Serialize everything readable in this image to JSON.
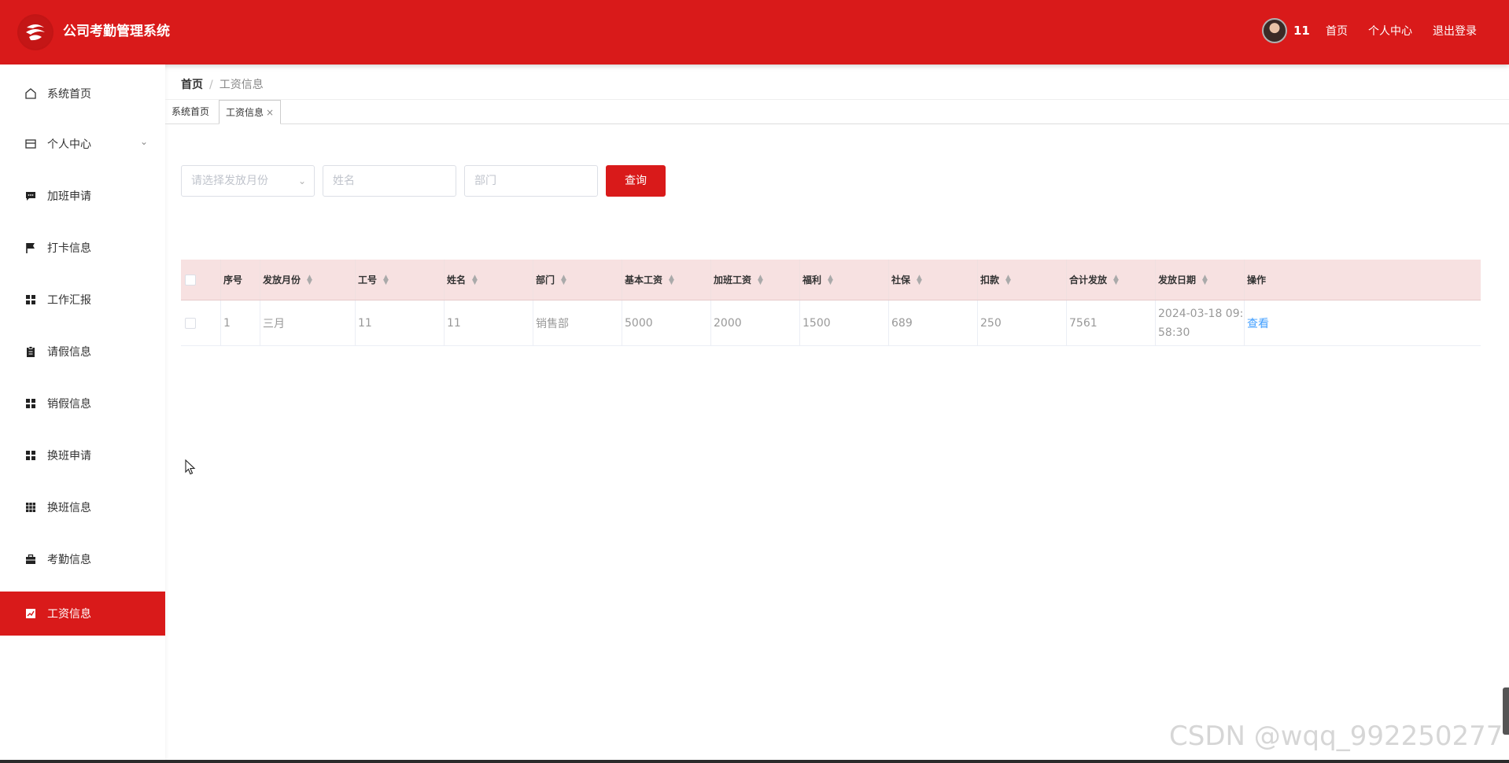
{
  "header": {
    "title": "公司考勤管理系统",
    "username": "11",
    "links": {
      "home": "首页",
      "profile": "个人中心",
      "logout": "退出登录"
    },
    "colors": {
      "primary": "#d91a1a"
    }
  },
  "sidebar": {
    "items": [
      {
        "label": "系统首页",
        "icon": "home-icon"
      },
      {
        "label": "个人中心",
        "icon": "wallet-icon"
      },
      {
        "label": "加班申请",
        "icon": "chat-icon"
      },
      {
        "label": "打卡信息",
        "icon": "flag-icon"
      },
      {
        "label": "工作汇报",
        "icon": "grid-icon"
      },
      {
        "label": "请假信息",
        "icon": "clipboard-icon"
      },
      {
        "label": "销假信息",
        "icon": "grid-icon"
      },
      {
        "label": "换班申请",
        "icon": "grid-icon"
      },
      {
        "label": "换班信息",
        "icon": "grid9-icon"
      },
      {
        "label": "考勤信息",
        "icon": "briefcase-icon"
      },
      {
        "label": "工资信息",
        "icon": "chart-icon"
      }
    ],
    "active_index": 10
  },
  "breadcrumb": {
    "home": "首页",
    "separator": "/",
    "current": "工资信息"
  },
  "tabs": [
    {
      "label": "系统首页"
    },
    {
      "label": "工资信息",
      "close": "×"
    }
  ],
  "search": {
    "month_placeholder": "请选择发放月份",
    "name_placeholder": "姓名",
    "dept_placeholder": "部门",
    "button": "查询"
  },
  "table": {
    "columns": [
      "序号",
      "发放月份",
      "工号",
      "姓名",
      "部门",
      "基本工资",
      "加班工资",
      "福利",
      "社保",
      "扣款",
      "合计发放",
      "发放日期",
      "操作"
    ],
    "rows": [
      {
        "index": "1",
        "month": "三月",
        "emp_no": "11",
        "name": "11",
        "dept": "销售部",
        "base_salary": "5000",
        "overtime_pay": "2000",
        "welfare": "1500",
        "social_security": "689",
        "deduction": "250",
        "total": "7561",
        "pay_date": "2024-03-18 09:58:30",
        "action": "查看"
      }
    ]
  },
  "watermark": "CSDN @wqq_992250277"
}
